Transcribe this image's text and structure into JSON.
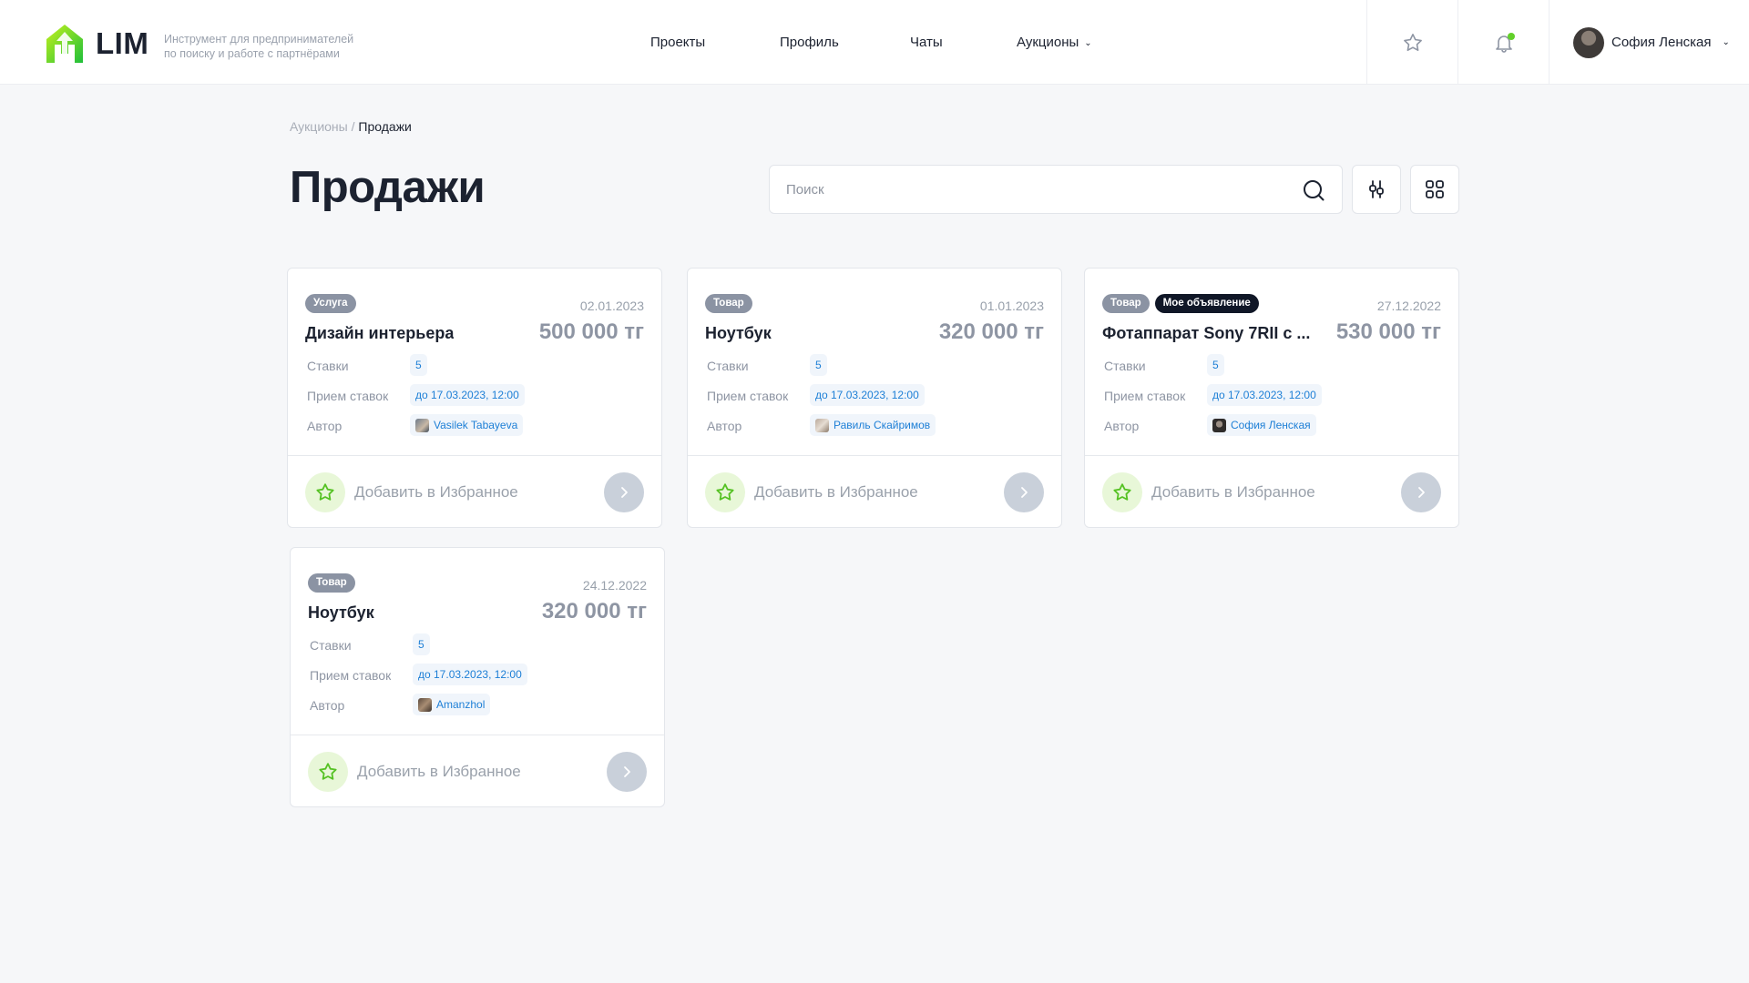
{
  "header": {
    "logo_text": "LIM",
    "tagline_line1": "Инструмент для предпринимателей",
    "tagline_line2": "по поиску и работе с партнёрами",
    "nav": [
      {
        "label": "Проекты"
      },
      {
        "label": "Профиль"
      },
      {
        "label": "Чаты"
      },
      {
        "label": "Аукционы"
      }
    ],
    "user_name": "София Ленская",
    "notification_dot_color": "#62d02a"
  },
  "breadcrumb": {
    "parent": "Аукционы",
    "separator": " / ",
    "current": "Продажи"
  },
  "page_title": "Продажи",
  "search": {
    "placeholder": "Поиск",
    "value": ""
  },
  "labels": {
    "bids": "Ставки",
    "accept": "Прием ставок",
    "author": "Автор",
    "favorite": "Добавить в Избранное"
  },
  "cards": [
    {
      "tags": [
        "Услуга"
      ],
      "date": "02.01.2023",
      "title": "Дизайн интерьера",
      "price": "500 000 тг",
      "bids": "5",
      "deadline": "до 17.03.2023, 12:00",
      "author": "Vasilek Tabayeva"
    },
    {
      "tags": [
        "Товар"
      ],
      "date": "01.01.2023",
      "title": "Ноутбук",
      "price": "320 000 тг",
      "bids": "5",
      "deadline": "до 17.03.2023, 12:00",
      "author": "Равиль Скайримов"
    },
    {
      "tags": [
        "Товар",
        "Мое объявление"
      ],
      "date": "27.12.2022",
      "title": "Фотаппарат Sony 7RII с ...",
      "price": "530 000 тг",
      "bids": "5",
      "deadline": "до 17.03.2023, 12:00",
      "author": "София Ленская"
    },
    {
      "tags": [
        "Товар"
      ],
      "date": "24.12.2022",
      "title": "Ноутбук",
      "price": "320 000 тг",
      "bids": "5",
      "deadline": "до 17.03.2023, 12:00",
      "author": "Amanzhol"
    }
  ],
  "colors": {
    "accent_green": "#62d02a",
    "link_blue": "#1d7fd6",
    "tag_gray": "#8b93a3",
    "tag_dark": "#101727"
  }
}
